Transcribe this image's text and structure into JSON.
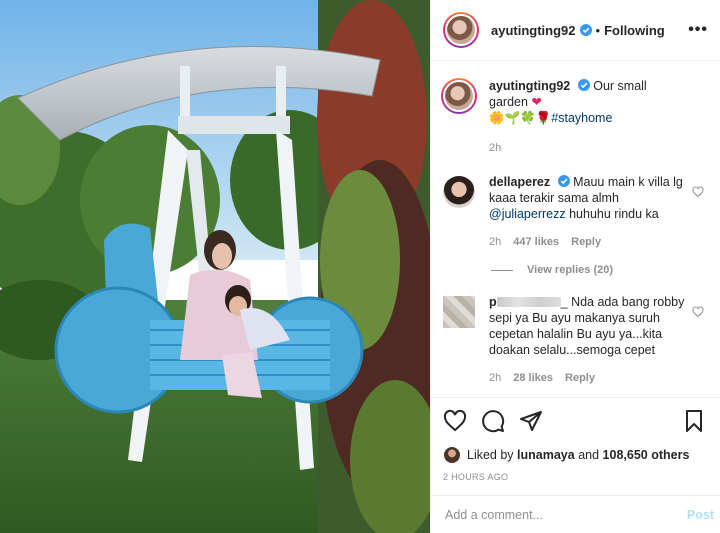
{
  "post": {
    "author": "ayutingting92",
    "follow_dot": "•",
    "follow_state": "Following",
    "more": "•••"
  },
  "caption": {
    "username": "ayutingting92",
    "text": "Our small garden",
    "heart": "❤",
    "emojis": "🌼🌱🍀🌹",
    "hashtag": "#stayhome",
    "time": "2h"
  },
  "comments": [
    {
      "username": "dellaperez",
      "text_before": "Mauu main k villa lg kaaa terakir sama almh",
      "mention": "@juliaperrezz",
      "text_after": "huhuhu rindu ka",
      "time": "2h",
      "likes": "447 likes",
      "reply": "Reply",
      "view_replies": "View replies (20)"
    },
    {
      "username_visible": "p",
      "text": "_ Nda ada bang robby sepi ya Bu ayu makanya suruh cepetan halalin Bu ayu ya...kita doakan selalu...semoga cepet",
      "time": "2h",
      "likes": "28 likes",
      "reply": "Reply"
    }
  ],
  "likes": {
    "prefix": "Liked by",
    "user": "lunamaya",
    "and": "and",
    "count": "108,650 others"
  },
  "timestamp": "2 HOURS AGO",
  "add_comment": {
    "placeholder": "Add a comment...",
    "post_label": "Post"
  },
  "icons": {
    "like": "heart-icon",
    "comment": "comment-icon",
    "share": "share-icon",
    "save": "bookmark-icon",
    "verified": "verified-badge-icon"
  },
  "colors": {
    "verified_blue": "#3897f0",
    "link": "#00376b",
    "muted": "#8e8e8e",
    "post_disabled": "#b2dffc",
    "swing_blue": "#4aa8d8"
  }
}
